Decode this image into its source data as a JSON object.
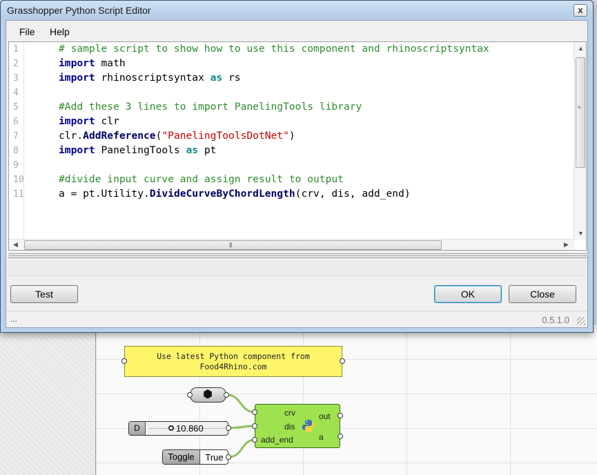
{
  "window": {
    "title": "Grasshopper Python Script Editor",
    "close_glyph": "x"
  },
  "menu": {
    "items": [
      "File",
      "Help"
    ]
  },
  "editor": {
    "line_numbers": [
      "1",
      "2",
      "3",
      "4",
      "5",
      "6",
      "7",
      "8",
      "9",
      "10",
      "11"
    ],
    "code": {
      "l1_comment": "# sample script to show how to use this component and rhinoscriptsyntax",
      "l2_kw": "import",
      "l2_rest": " math",
      "l3_kw": "import",
      "l3_mid": " rhinoscriptsyntax ",
      "l3_as": "as",
      "l3_rest": " rs",
      "l5_comment": "#Add these 3 lines to import PanelingTools library",
      "l6_kw": "import",
      "l6_rest": " clr",
      "l7_obj": "clr.",
      "l7_fn": "AddReference",
      "l7_open": "(",
      "l7_str": "\"PanelingToolsDotNet\"",
      "l7_close": ")",
      "l8_kw": "import",
      "l8_mid": " PanelingTools ",
      "l8_as": "as",
      "l8_rest": " pt",
      "l10_comment": "#divide input curve and assign result to output",
      "l11_pre": "a = pt.Utility.",
      "l11_fn": "DivideCurveByChordLength",
      "l11_rest": "(crv, dis, add_end)"
    }
  },
  "buttons": {
    "test": "Test",
    "ok": "OK",
    "close": "Close"
  },
  "statusbar": {
    "left": "...",
    "version": "0.5.1.0"
  },
  "canvas": {
    "panel_lines": [
      "Use latest Python component from",
      "Food4Rhino.com"
    ],
    "python_component": {
      "inputs": [
        "crv",
        "dis",
        "add_end"
      ],
      "outputs": [
        "out",
        "a"
      ]
    },
    "slider": {
      "label": "D",
      "value": "10.860"
    },
    "toggle": {
      "label": "Toggle",
      "value": "True"
    }
  },
  "colors": {
    "panel_yellow": "#fff56b",
    "component_green": "#9fe24f",
    "wire_green": "#8fc15a",
    "comment_green": "#2e8b2e",
    "keyword_blue": "#00008b",
    "string_red": "#c00000"
  }
}
